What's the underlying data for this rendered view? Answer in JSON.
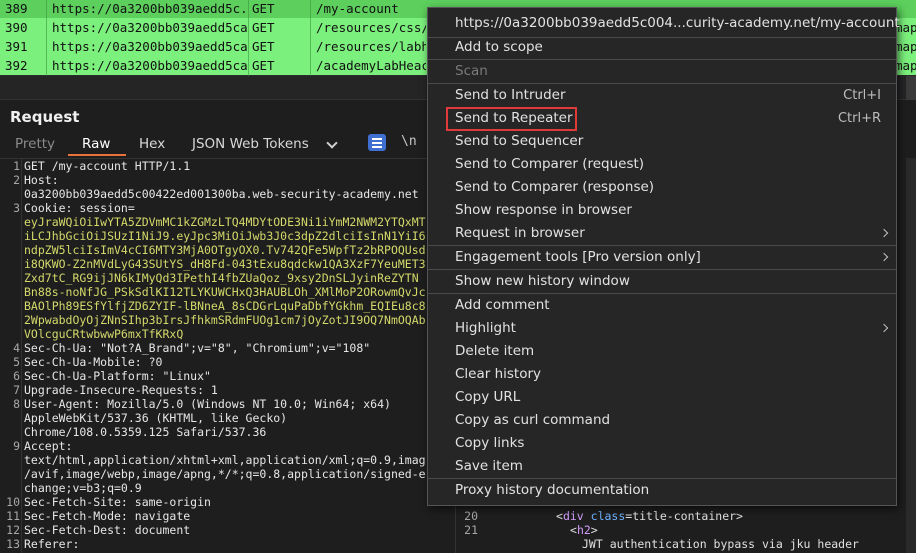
{
  "history": {
    "rows": [
      {
        "num": "389",
        "url": "https://0a3200bb039aedd5c...",
        "method": "GET",
        "path": "/my-account",
        "extra": ""
      },
      {
        "num": "390",
        "url": "https://0a3200bb039aedd5ca...",
        "method": "GET",
        "path": "/resources/css/lal",
        "extra": "map"
      },
      {
        "num": "391",
        "url": "https://0a3200bb039aedd5ca...",
        "method": "GET",
        "path": "/resources/labhea",
        "extra": "map"
      },
      {
        "num": "392",
        "url": "https://0a3200bb039aedd5ca...",
        "method": "GET",
        "path": "/academyLabHeac",
        "extra": "map"
      }
    ],
    "row_colors": {
      "highlight": "#7cf07c"
    }
  },
  "request": {
    "title": "Request",
    "tabs": {
      "pretty": "Pretty",
      "raw": "Raw",
      "hex": "Hex",
      "json_web_tokens": "JSON Web Tokens"
    },
    "newline_toggle": "\\n",
    "lines": [
      {
        "n": "1",
        "text": "GET /my-account HTTP/1.1"
      },
      {
        "n": "2",
        "text": "Host:"
      },
      {
        "n": "",
        "text": "0a3200bb039aedd5c00422ed001300ba.web-security-academy.net"
      },
      {
        "n": "3",
        "text": "Cookie: ",
        "val": "session="
      },
      {
        "n": "",
        "cv": "eyJraWQiOiIwYTA5ZDVmMC1kZGMzLTQ4MDYtODE3Ni1iYmM2NWM2YTQxMT"
      },
      {
        "n": "",
        "cv": "iLCJhbGciOiJSUzI1NiJ9.eyJpc3MiOiJwb3J0c3dpZ2dlciIsInN1YiI6"
      },
      {
        "n": "",
        "cv": "ndpZW5lciIsImV4cCI6MTY3MjA0OTgyOX0.Tv742QFe5WpfTz2bRPOQUsd"
      },
      {
        "n": "",
        "cv": "i8QKWO-Z2nMVdLyG43SUtYS_dH8Fd-043tExu8qdckw1QA3XzF7YeuMET3"
      },
      {
        "n": "",
        "cv": "Zxd7tC_RG9ijJN6kIMyQd3IPethI4fbZUaQoz_9xsy2DnSLJyinReZYTN"
      },
      {
        "n": "",
        "cv": "Bn88s-noNfJG_PSkSdlKI12TLYKUWCHxQ3HAUBLOh_XMlMoP2ORowmQvJc"
      },
      {
        "n": "",
        "cv": "BAOlPh89ESfYlfjZD6ZYIF-lBNneA_8sCDGrLquPaDbfYGkhm_EQIEu8c8"
      },
      {
        "n": "",
        "cv": "2WpwabdOyOjZNnSIhp3bIrsJfhkmSRdmFUOg1cm7jOyZotJI9OQ7NmOQAb"
      },
      {
        "n": "",
        "cv": "VOlcguCRtwbwwP6mxTfKRxQ"
      },
      {
        "n": "4",
        "text": "Sec-Ch-Ua: \"Not?A_Brand\";v=\"8\", \"Chromium\";v=\"108\""
      },
      {
        "n": "5",
        "text": "Sec-Ch-Ua-Mobile: ?0"
      },
      {
        "n": "6",
        "text": "Sec-Ch-Ua-Platform: \"Linux\""
      },
      {
        "n": "7",
        "text": "Upgrade-Insecure-Requests: 1"
      },
      {
        "n": "8",
        "text": "User-Agent: Mozilla/5.0 (Windows NT 10.0; Win64; x64)"
      },
      {
        "n": "",
        "text": "AppleWebKit/537.36 (KHTML, like Gecko)"
      },
      {
        "n": "",
        "text": "Chrome/108.0.5359.125 Safari/537.36"
      },
      {
        "n": "9",
        "text": "Accept:"
      },
      {
        "n": "",
        "text": "text/html,application/xhtml+xml,application/xml;q=0.9,imag"
      },
      {
        "n": "",
        "text": "/avif,image/webp,image/apng,*/*;q=0.8,application/signed-e"
      },
      {
        "n": "",
        "text": "change;v=b3;q=0.9"
      },
      {
        "n": "10",
        "text": "Sec-Fetch-Site: same-origin"
      },
      {
        "n": "11",
        "text": "Sec-Fetch-Mode: navigate"
      },
      {
        "n": "12",
        "text": "Sec-Fetch-Dest: document"
      },
      {
        "n": "13",
        "text": "Referer:"
      }
    ]
  },
  "response": {
    "lines": [
      {
        "n": "20",
        "pre": "<",
        "tag": "div",
        "attr": " class",
        "rest": "=title-container>"
      },
      {
        "n": "21",
        "pre": "<",
        "tag": "h2",
        "attr": "",
        "rest": ">"
      },
      {
        "n": "",
        "pre": "",
        "tag": "",
        "attr": "",
        "rest": "JWT authentication bypass via jku header"
      }
    ]
  },
  "context_menu": {
    "header_url": "https://0a3200bb039aedd5c004...curity-academy.net/my-account",
    "items": [
      {
        "label": "Add to scope",
        "shortcut": "",
        "submenu": false,
        "disabled": false
      },
      {
        "label": "Scan",
        "shortcut": "",
        "submenu": false,
        "disabled": true
      },
      {
        "label": "Send to Intruder",
        "shortcut": "Ctrl+I",
        "submenu": false,
        "disabled": false
      },
      {
        "label": "Send to Repeater",
        "shortcut": "Ctrl+R",
        "submenu": false,
        "disabled": false
      },
      {
        "label": "Send to Sequencer",
        "shortcut": "",
        "submenu": false,
        "disabled": false
      },
      {
        "label": "Send to Comparer (request)",
        "shortcut": "",
        "submenu": false,
        "disabled": false
      },
      {
        "label": "Send to Comparer (response)",
        "shortcut": "",
        "submenu": false,
        "disabled": false
      },
      {
        "label": "Show response in browser",
        "shortcut": "",
        "submenu": false,
        "disabled": false
      },
      {
        "label": "Request in browser",
        "shortcut": "",
        "submenu": true,
        "disabled": false
      },
      {
        "label": "Engagement tools [Pro version only]",
        "shortcut": "",
        "submenu": true,
        "disabled": false
      },
      {
        "label": "Show new history window",
        "shortcut": "",
        "submenu": false,
        "disabled": false
      },
      {
        "label": "Add comment",
        "shortcut": "",
        "submenu": false,
        "disabled": false
      },
      {
        "label": "Highlight",
        "shortcut": "",
        "submenu": true,
        "disabled": false
      },
      {
        "label": "Delete item",
        "shortcut": "",
        "submenu": false,
        "disabled": false
      },
      {
        "label": "Clear history",
        "shortcut": "",
        "submenu": false,
        "disabled": false
      },
      {
        "label": "Copy URL",
        "shortcut": "",
        "submenu": false,
        "disabled": false
      },
      {
        "label": "Copy as curl command",
        "shortcut": "",
        "submenu": false,
        "disabled": false
      },
      {
        "label": "Copy links",
        "shortcut": "",
        "submenu": false,
        "disabled": false
      },
      {
        "label": "Save item",
        "shortcut": "",
        "submenu": false,
        "disabled": false
      },
      {
        "label": "Proxy history documentation",
        "shortcut": "",
        "submenu": false,
        "disabled": false
      }
    ],
    "highlighted_item": "Send to Repeater",
    "highlight_color": "#e03a3a"
  }
}
